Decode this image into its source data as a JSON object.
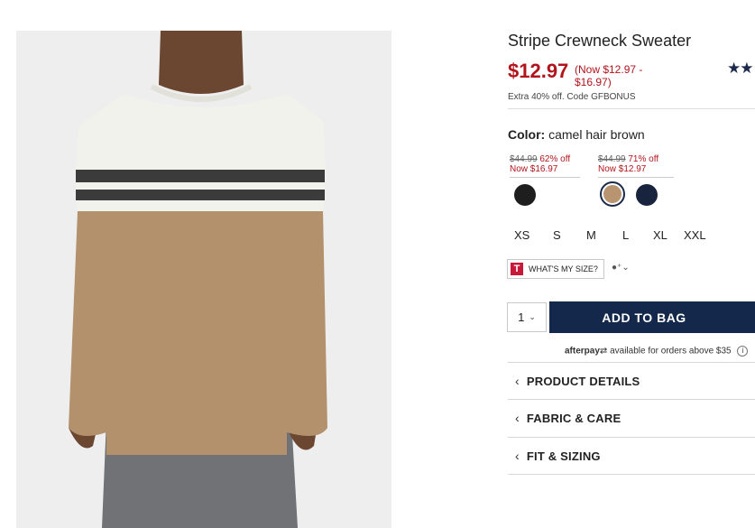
{
  "product": {
    "title": "Stripe Crewneck Sweater",
    "price": "$12.97",
    "price_range": "(Now $12.97 - $16.97)",
    "rating_stars": "★★",
    "promo": "Extra 40% off. Code GFBONUS"
  },
  "color": {
    "label": "Color:",
    "value": "camel hair brown",
    "groups": [
      {
        "was": "$44.99",
        "off": "62% off",
        "now": "Now $16.97"
      },
      {
        "was": "$44.99",
        "off": "71% off",
        "now": "Now $12.97"
      }
    ],
    "swatches": [
      {
        "name": "black",
        "hex": "#1e1e1e"
      },
      {
        "name": "camel hair brown",
        "hex": "#b99470",
        "selected": true
      },
      {
        "name": "navy",
        "hex": "#18233d"
      }
    ]
  },
  "sizes": [
    "XS",
    "S",
    "M",
    "L",
    "XL",
    "XXL"
  ],
  "fit": {
    "button_label": "WHAT'S MY SIZE?",
    "logo_letter": "T",
    "profile_glyph": "●⁺⌄"
  },
  "cart": {
    "quantity": "1",
    "add_label": "ADD TO BAG"
  },
  "afterpay": {
    "brand": "afterpay",
    "text": "available for orders above $35",
    "info": "i"
  },
  "accordion": [
    {
      "label": "PRODUCT DETAILS"
    },
    {
      "label": "FABRIC & CARE"
    },
    {
      "label": "FIT & SIZING"
    }
  ],
  "colors": {
    "sale_red": "#b3141b",
    "navy_button": "#14284b"
  },
  "icons": {
    "accordion": "chevron-left-icon",
    "quantity": "chevron-down-icon",
    "info": "info-icon"
  }
}
